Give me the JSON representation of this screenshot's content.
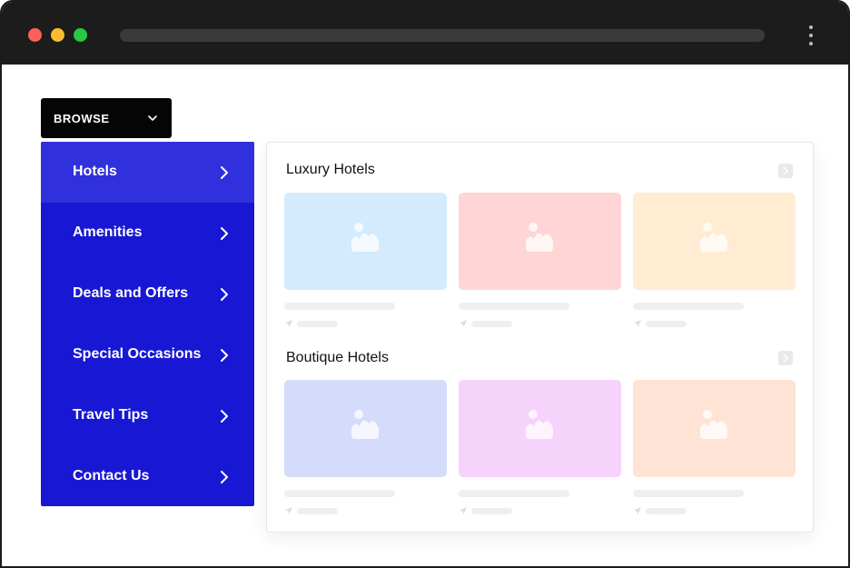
{
  "browse": {
    "label": "BROWSE"
  },
  "menu": {
    "items": [
      {
        "label": "Hotels",
        "active": true
      },
      {
        "label": "Amenities",
        "active": false
      },
      {
        "label": "Deals and Offers",
        "active": false
      },
      {
        "label": "Special Occasions",
        "active": false
      },
      {
        "label": "Travel Tips",
        "active": false
      },
      {
        "label": "Contact Us",
        "active": false
      }
    ]
  },
  "sections": [
    {
      "title": "Luxury Hotels",
      "cards": [
        {
          "color": "#d4ebfd",
          "icon": "image-placeholder-icon"
        },
        {
          "color": "#ffd5d5",
          "icon": "image-placeholder-icon"
        },
        {
          "color": "#ffecd2",
          "icon": "image-placeholder-icon"
        }
      ]
    },
    {
      "title": "Boutique Hotels",
      "cards": [
        {
          "color": "#d5dcfb",
          "icon": "image-placeholder-icon"
        },
        {
          "color": "#f5d3fb",
          "icon": "image-placeholder-icon"
        },
        {
          "color": "#ffe3d4",
          "icon": "image-placeholder-icon"
        }
      ]
    }
  ],
  "colors": {
    "menu_bg": "#1818d4",
    "menu_active": "#3030dc",
    "browse_bg": "#050505",
    "titlebar": "#1c1c1c"
  }
}
